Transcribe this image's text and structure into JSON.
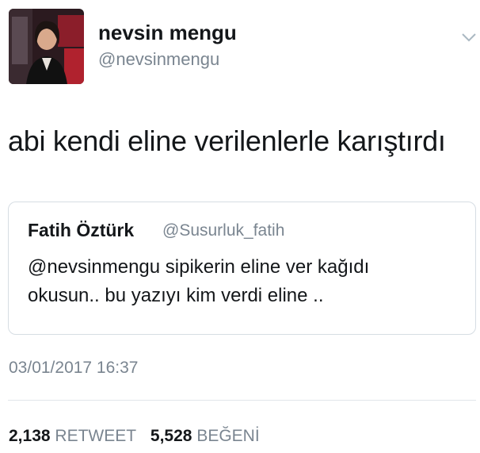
{
  "user": {
    "display_name": "nevsin mengu",
    "handle": "@nevsinmengu",
    "avatar_icon": "profile-photo"
  },
  "menu_icon": "chevron-down-icon",
  "tweet": {
    "text": "abi kendi eline verilenlerle karıştırdı"
  },
  "quoted": {
    "display_name": "Fatih Öztürk",
    "handle": "@Susurluk_fatih",
    "lines": [
      "@nevsinmengu sipikerin eline ver kağıdı",
      "okusun.. bu yazıyı kim verdi eline .."
    ]
  },
  "timestamp": "03/01/2017 16:37",
  "stats": {
    "retweets_count": "2,138",
    "retweets_label": "RETWEET",
    "likes_count": "5,528",
    "likes_label": "BEĞENİ"
  },
  "colors": {
    "text": "#14171a",
    "secondary": "#7a8590",
    "border": "#d6dde3"
  }
}
